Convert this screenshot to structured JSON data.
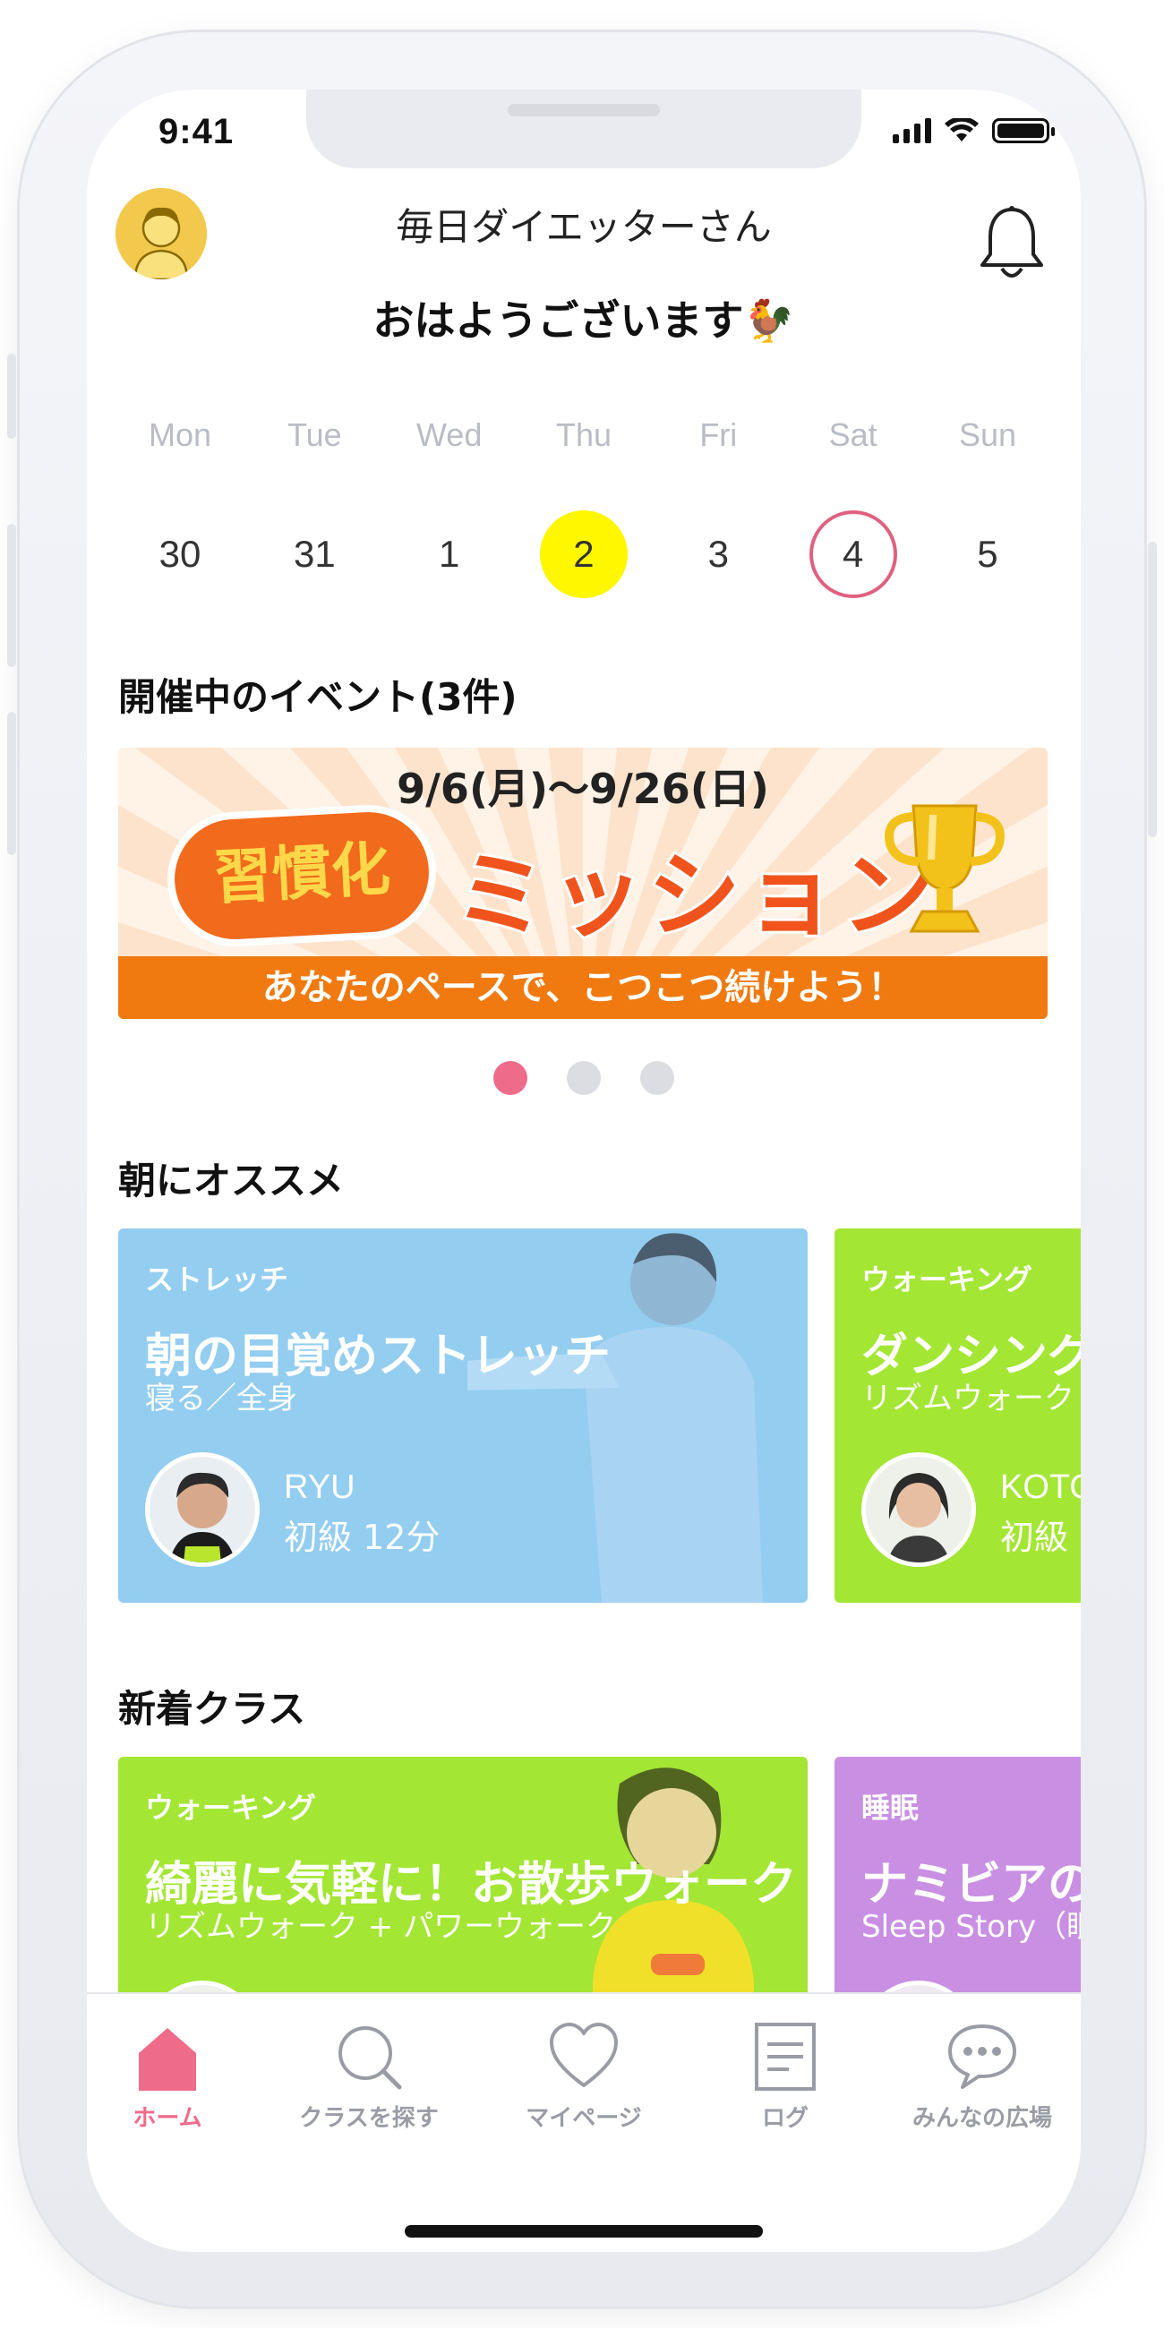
{
  "status": {
    "time": "9:41"
  },
  "header": {
    "username": "毎日ダイエッターさん",
    "greeting": "おはようございます🐓"
  },
  "week": {
    "days": [
      {
        "name": "Mon",
        "num": "30"
      },
      {
        "name": "Tue",
        "num": "31"
      },
      {
        "name": "Wed",
        "num": "1"
      },
      {
        "name": "Thu",
        "num": "2"
      },
      {
        "name": "Fri",
        "num": "3"
      },
      {
        "name": "Sat",
        "num": "4"
      },
      {
        "name": "Sun",
        "num": "5"
      }
    ],
    "today_color": "#fff700",
    "marked_color": "#e0607e"
  },
  "events": {
    "title": "開催中のイベント(3件)",
    "banner": {
      "date": "9/6(月)〜9/26(日)",
      "badge": "習慣化",
      "headline": "ミッション",
      "tagline": "あなたのペースで、こつこつ続けよう！"
    },
    "page_count": 3,
    "active_page": 1
  },
  "morning": {
    "title": "朝にオススメ",
    "cards": [
      {
        "category": "ストレッチ",
        "title": "朝の目覚めストレッチ",
        "subtitle": "寝る／全身",
        "instructor": "RYU",
        "meta": "初級 12分",
        "color": "#93cdf0"
      },
      {
        "category": "ウォーキング",
        "title": "ダンシング",
        "subtitle": "リズムウォーク +",
        "instructor": "KOTO",
        "meta": "初級",
        "color": "#a3e633"
      }
    ]
  },
  "new_classes": {
    "title": "新着クラス",
    "cards": [
      {
        "category": "ウォーキング",
        "title": "綺麗に気軽に！お散歩ウォーク",
        "subtitle": "リズムウォーク + パワーウォーク",
        "color": "#a3e633"
      },
      {
        "category": "睡眠",
        "title": "ナミビアの",
        "subtitle": "Sleep Story（眠",
        "color": "#c98fe3"
      }
    ]
  },
  "tabbar": {
    "items": [
      {
        "label": "ホーム",
        "icon": "home-icon",
        "active": true
      },
      {
        "label": "クラスを探す",
        "icon": "search-icon",
        "active": false
      },
      {
        "label": "マイページ",
        "icon": "heart-icon",
        "active": false
      },
      {
        "label": "ログ",
        "icon": "log-icon",
        "active": false
      },
      {
        "label": "みんなの広場",
        "icon": "chat-bubble-icon",
        "active": false
      }
    ],
    "active_color": "#ef6b8a"
  }
}
